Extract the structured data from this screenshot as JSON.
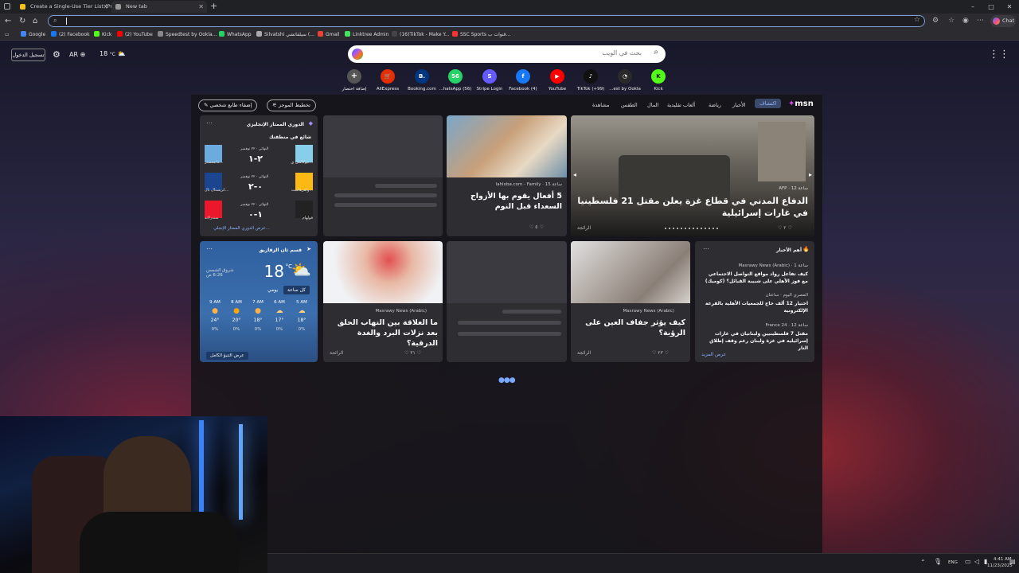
{
  "browser": {
    "tabs": [
      {
        "title": "Create a Single-Use Tier List (Priv..."
      },
      {
        "title": "New tab"
      }
    ],
    "new_tab": "+",
    "window_controls": {
      "minimize": "–",
      "maximize": "□",
      "close": "✕"
    },
    "chat_label": "Chat"
  },
  "bookmarks": [
    {
      "label": "Google",
      "color": "#4285f4"
    },
    {
      "label": "(2) Facebook",
      "color": "#1877f2"
    },
    {
      "label": "Kick",
      "color": "#53fc18"
    },
    {
      "label": "(2) YouTube",
      "color": "#ff0000"
    },
    {
      "label": "Speedtest by Ookla...",
      "color": "#888888"
    },
    {
      "label": "WhatsApp",
      "color": "#25d366"
    },
    {
      "label": "Silvatshi سيلفاتشي (...",
      "color": "#aaaaaa"
    },
    {
      "label": "Gmail",
      "color": "#ea4335"
    },
    {
      "label": "Linktree Admin",
      "color": "#43e55e"
    },
    {
      "label": "(16)TikTok - Make Y...",
      "color": "#111111"
    },
    {
      "label": "SSC Sports قنوات ب...",
      "color": "#ff3333"
    }
  ],
  "ntp": {
    "signin": "تسجيل الدخول",
    "lang": "AR",
    "temp": "18",
    "temp_unit": "°C",
    "search_placeholder": "بحث في الويب",
    "quicklinks": [
      {
        "label": "Kick",
        "glyph": "K",
        "color": "#53fc18"
      },
      {
        "label": "...est by Ookla",
        "glyph": "◔",
        "color": "#2a2a2a"
      },
      {
        "label": "TikTok (+99)",
        "glyph": "♪",
        "color": "#111111"
      },
      {
        "label": "YouTube",
        "glyph": "▶",
        "color": "#ff0000"
      },
      {
        "label": "Facebook (4)",
        "glyph": "f",
        "color": "#1877f2"
      },
      {
        "label": "Stripe Login",
        "glyph": "S",
        "color": "#635bff"
      },
      {
        "label": "...hatsApp (56)",
        "glyph": "56",
        "color": "#25d366"
      },
      {
        "label": "Booking.com",
        "glyph": "B.",
        "color": "#003580"
      },
      {
        "label": "AliExpress",
        "glyph": "🛒",
        "color": "#e62e04"
      },
      {
        "label": "إضافة اختصار",
        "glyph": "+",
        "color": "#555555"
      }
    ]
  },
  "feed": {
    "brand": "msn",
    "nav": [
      "اكتشاف",
      "الأخبار",
      "رياضة",
      "ألعاب تقليدية",
      "المال",
      "الطقس",
      "مشاهدة"
    ],
    "layout_pill": "تخطيط الموجز",
    "personalize_pill": "إضفاء طابع شخصي",
    "hero": {
      "source": "AFP · 12 ساعة",
      "title": "الدفاع المدني في قطاع غزة يعلن مقتل 21 فلسطينيا في غارات إسرائيلية",
      "likes": "٢",
      "hero_badge": "الرائجة"
    },
    "family_card": {
      "source": "lahloba.com - Family · 15 ساعة",
      "title": "5 أفعال يقوم بها الأزواج السعداء قبل النوم",
      "likes": "٥"
    },
    "sports": {
      "title": "الدوري الممتاز الإنجليزي",
      "subtitle": "شائع في منطقتك",
      "matches": [
        {
          "home": "نيوكاسل ي...",
          "away": "مانشستر...",
          "score": "٢-١",
          "status": "النهائي · ٢٢ نوفمبر"
        },
        {
          "home": "ولفرهامبت...",
          "away": "كريستال بال...",
          "score": "٠-٢",
          "status": "النهائي · ٢٢ نوفمبر"
        },
        {
          "home": "فولهام",
          "away": "سندرلاند",
          "score": "١-٠",
          "status": "النهائي · ٢٢ نوفمبر"
        }
      ],
      "footer": "عرض الدوري الممتاز الإنجلي..."
    },
    "top_news": {
      "title": "أهم الأخبار",
      "items": [
        {
          "source": "Masrawy News (Arabic) · 1 ساعة",
          "text": "كيف تفاعل رواد مواقع التواصل الاجتماعي مع فوز الأهلي على شبيبة القبائل؟ (كوميك)"
        },
        {
          "source": "المصري اليوم · ساعتان",
          "text": "اختيار 12 ألف حاج للجمعيات الأهلية بالقرعة الإلكترونية"
        },
        {
          "source": "France 24 · 12 ساعة",
          "text": "مقتل 7 فلسطينيين ولبنانيان في غارات إسرائيلية في غزة ولبنان رغم وقف إطلاق النار"
        }
      ],
      "more": "عرض المزيد"
    },
    "eye_card": {
      "source": "Masrawy News (Arabic)",
      "title": "كيف يؤثر جفاف العين على الرؤية؟",
      "likes": "٢٣",
      "badge": "الرائجة"
    },
    "throat_card": {
      "source": "Masrawy News (Arabic)",
      "title": "ما العلاقة بين التهاب الحلق بعد نزلات البرد والغدة الدرقية؟",
      "likes": "٣١",
      "badge": "الرائجة"
    },
    "weather": {
      "location": "قسم ثان الزقازيق",
      "temp": "18",
      "unit": "°C",
      "desc": "شروق الشمس 6:26 ص",
      "tabs": [
        "كل ساعة",
        "يومي"
      ],
      "hours": [
        {
          "time": "5 AM",
          "temp": "18°",
          "rain": "0%"
        },
        {
          "time": "6 AM",
          "temp": "17°",
          "rain": "0%"
        },
        {
          "time": "7 AM",
          "temp": "18°",
          "rain": "0%"
        },
        {
          "time": "8 AM",
          "temp": "20°",
          "rain": "0%"
        },
        {
          "time": "9 AM",
          "temp": "24°",
          "rain": "0%"
        }
      ],
      "footer": "عرض التنبؤ الكامل"
    }
  },
  "taskbar": {
    "lang": "ENG",
    "time": "4:41 AM",
    "date": "11/23/2025"
  }
}
